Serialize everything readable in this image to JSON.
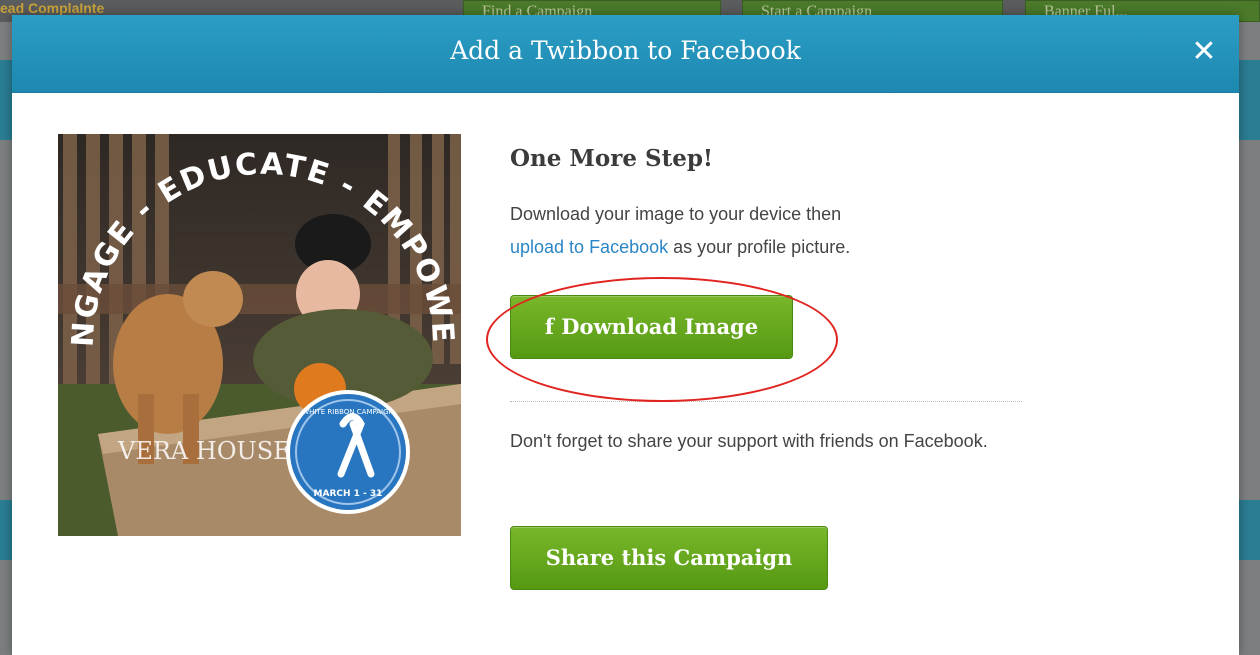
{
  "background": {
    "top_text": "ead ComplaInte",
    "buttons": [
      "Find a Campaign",
      "Start a Campaign",
      "Banner Ful..."
    ]
  },
  "modal": {
    "title": "Add a Twibbon to Facebook",
    "close_glyph": "✕"
  },
  "preview": {
    "arc_text": "ENGAGE - EDUCATE - EMPOWER",
    "logo_text": "VERA HOUSE",
    "badge_top": "WHITE RIBBON CAMPAIGN",
    "badge_bottom": "MARCH 1 - 31"
  },
  "content": {
    "heading": "One More Step!",
    "instruction_pre": "Download your image to your device then",
    "instruction_link": "upload to Facebook",
    "instruction_post": " as your profile picture.",
    "download_label": "Download Image",
    "download_icon": "f",
    "share_text": "Don't forget to share your support with friends on Facebook.",
    "share_label": "Share this Campaign"
  },
  "colors": {
    "header": "#1d88b0",
    "button_green": "#559913",
    "link": "#2b86c5",
    "annotation": "#e0241f"
  },
  "icons": {
    "close": "close-icon",
    "facebook": "facebook-icon"
  }
}
